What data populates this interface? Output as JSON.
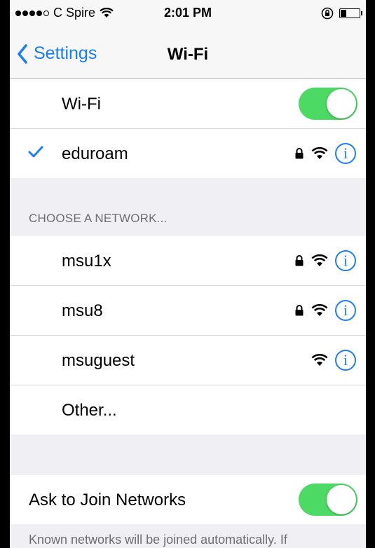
{
  "status_bar": {
    "signal_bars": 5,
    "signal_filled": 4,
    "carrier": "C Spire",
    "time": "2:01 PM",
    "battery_level": 0.3
  },
  "nav": {
    "back_label": "Settings",
    "title": "Wi-Fi"
  },
  "wifi_toggle": {
    "label": "Wi-Fi",
    "on": true
  },
  "connected_network": {
    "name": "eduroam",
    "secured": true
  },
  "choose_header": "CHOOSE A NETWORK...",
  "networks": [
    {
      "name": "msu1x",
      "secured": true
    },
    {
      "name": "msu8",
      "secured": true
    },
    {
      "name": "msuguest",
      "secured": false
    }
  ],
  "other_label": "Other...",
  "ask_to_join": {
    "label": "Ask to Join Networks",
    "on": true
  },
  "footer_text": "Known networks will be joined automatically. If",
  "colors": {
    "accent": "#1a7efb",
    "toggle_on": "#4cd964",
    "background": "#efeff4"
  },
  "icons": [
    "wifi-icon",
    "lock-icon",
    "info-icon",
    "checkmark-icon",
    "chevron-left-icon",
    "orientation-lock-icon"
  ]
}
